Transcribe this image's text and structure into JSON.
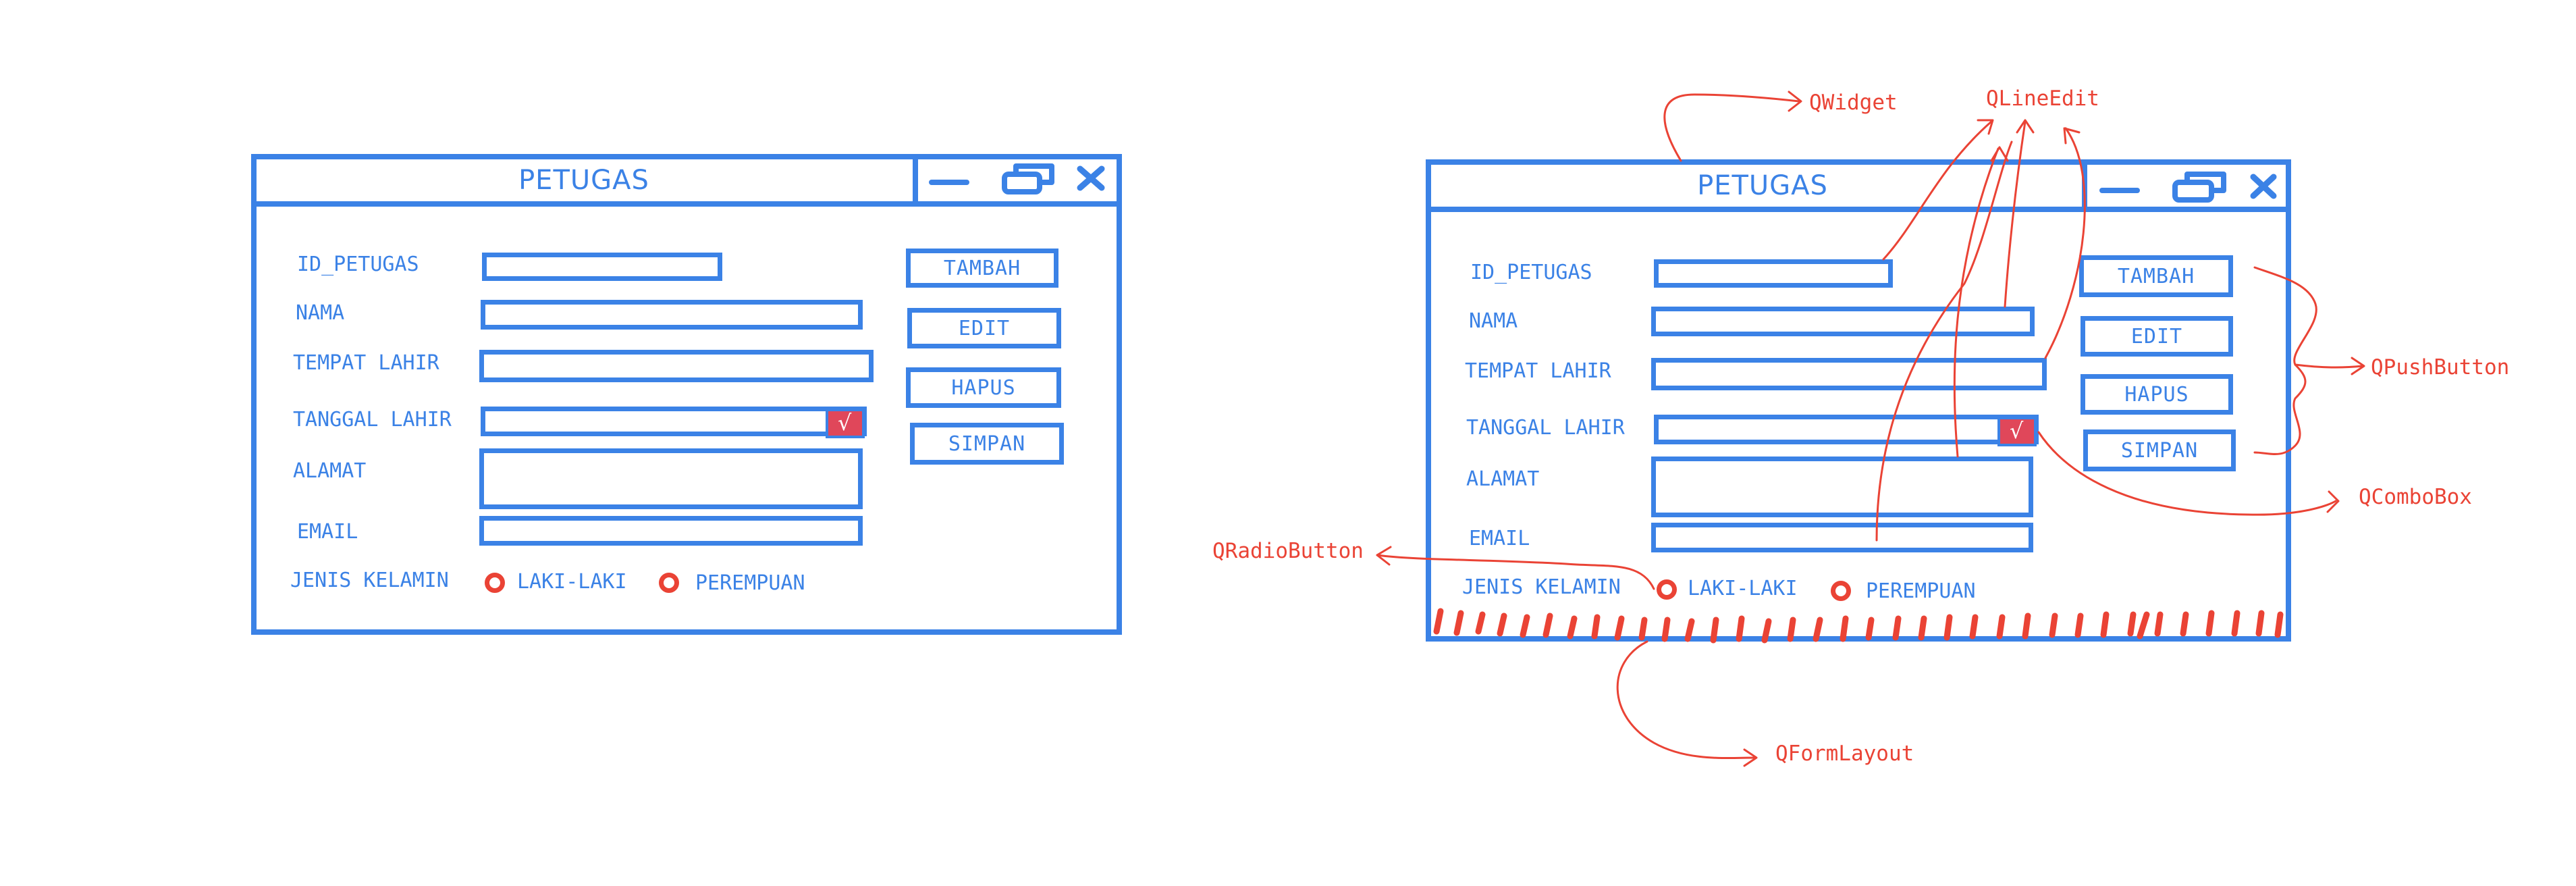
{
  "form": {
    "title": "PETUGAS",
    "labels": {
      "id_petugas": "ID_PETUGAS",
      "nama": "NAMA",
      "tempat_lahir": "TEMPAT LAHIR",
      "tanggal_lahir": "TANGGAL LAHIR",
      "alamat": "ALAMAT",
      "email": "EMAIL",
      "jenis_kelamin": "JENIS KELAMIN"
    },
    "radio_options": [
      "LAKI-LAKI",
      "PEREMPUAN"
    ],
    "buttons": [
      "TAMBAH",
      "EDIT",
      "HAPUS",
      "SIMPAN"
    ],
    "combo_glyph": "√"
  },
  "annotations": {
    "widget": "QWidget",
    "line_edit": "QLineEdit",
    "push_button": "QPushButton",
    "combo_box": "QComboBox",
    "radio_button": "QRadioButton",
    "form_layout": "QFormLayout"
  },
  "colors": {
    "sketch_blue": "#3b82e6",
    "annotation_red": "#ea4335",
    "combo_fill": "#e0475a"
  },
  "icons": [
    "minimize-icon",
    "restore-icon",
    "close-icon",
    "dropdown-check-icon",
    "radio-icon"
  ]
}
